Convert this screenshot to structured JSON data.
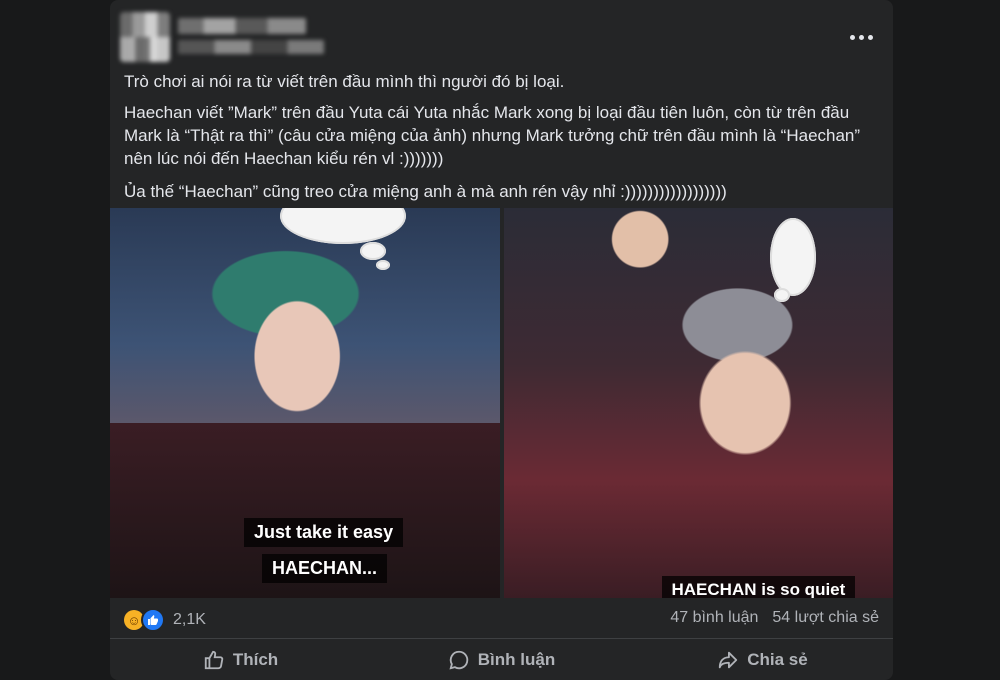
{
  "post": {
    "paragraphs": [
      "Trò chơi ai nói ra từ viết trên đầu mình thì người đó bị loại.",
      "Haechan viết ”Mark” trên đầu Yuta cái Yuta nhắc Mark xong bị loại đầu tiên luôn, còn từ trên đầu Mark là “Thật ra thì” (câu cửa miệng của ảnh) nhưng Mark tưởng chữ trên đầu mình là “Haechan” nên lúc nói đến Haechan kiểu rén vl :)))))))",
      "Ủa thế “Haechan” cũng treo cửa miệng anh à mà anh rén vậy nhỉ :))))))))))))))))))"
    ]
  },
  "images": {
    "left": {
      "subtitle_line1": "Just take it easy",
      "subtitle_line2": "HAECHAN..."
    },
    "right": {
      "subtitle": "HAECHAN is so quiet"
    }
  },
  "stats": {
    "reaction_count": "2,1K",
    "comments": "47 bình luận",
    "shares": "54 lượt chia sẻ"
  },
  "actions": {
    "like": "Thích",
    "comment": "Bình luận",
    "share": "Chia sẻ"
  },
  "icons": {
    "reaction_1": "haha-icon",
    "reaction_2": "like-icon",
    "more": "more-icon"
  }
}
